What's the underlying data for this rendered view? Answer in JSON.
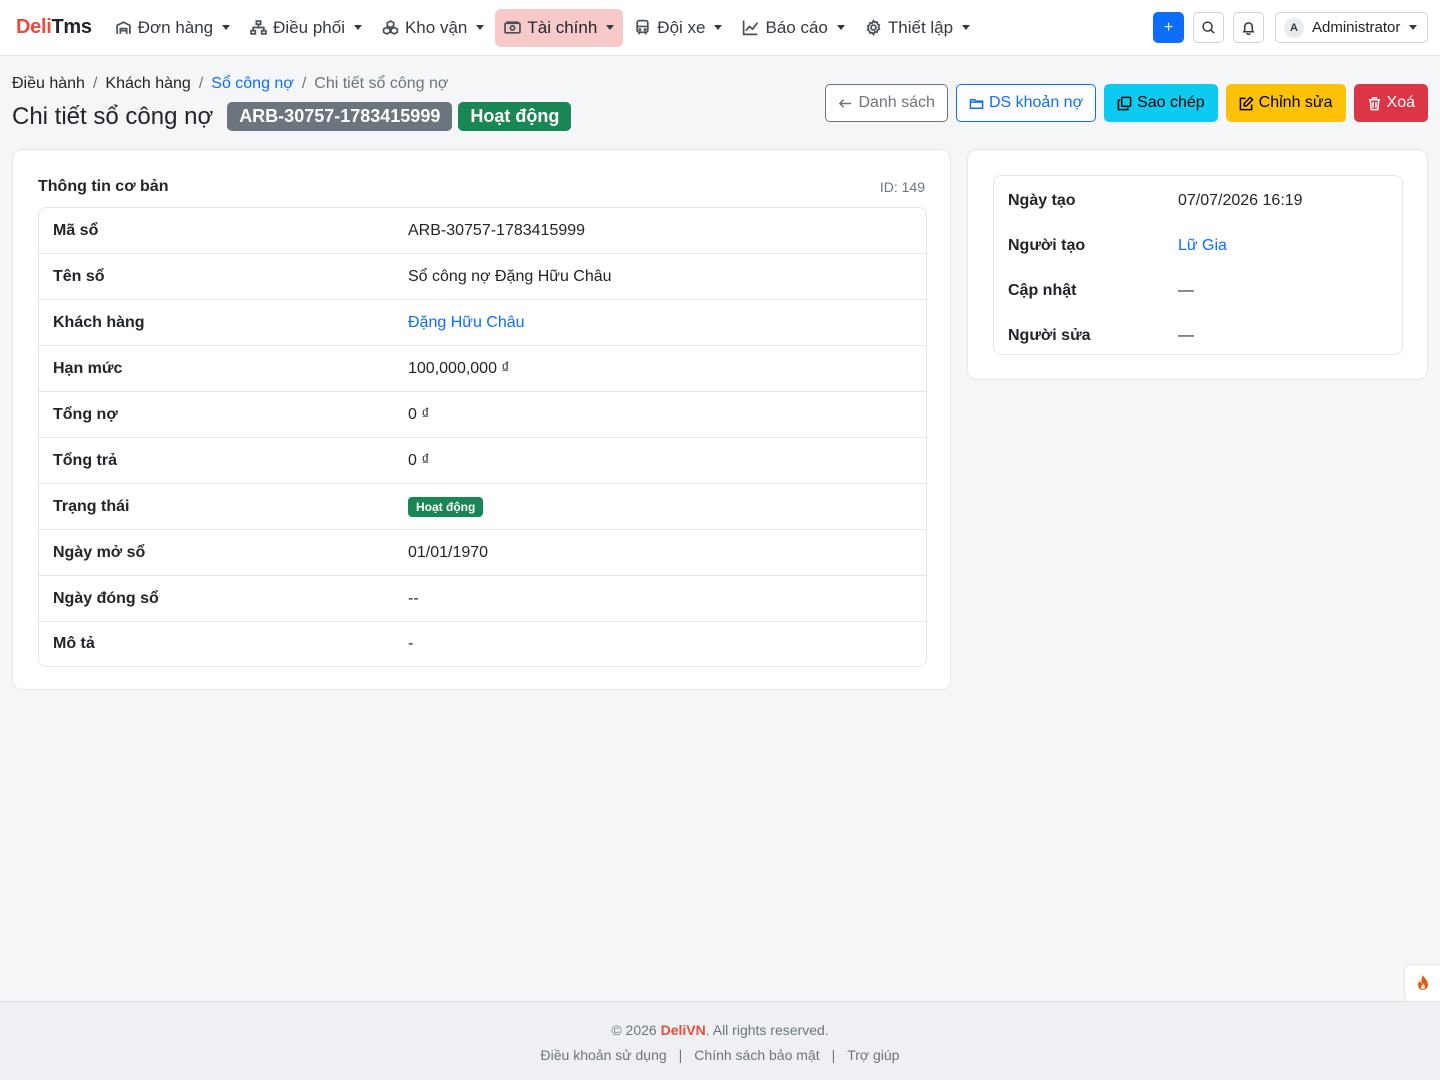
{
  "brand": {
    "part1": "Deli",
    "part2": "Tms"
  },
  "nav": {
    "items": [
      {
        "label": "Đơn hàng",
        "icon": "warehouse-icon"
      },
      {
        "label": "Điều phối",
        "icon": "sitemap-icon"
      },
      {
        "label": "Kho vận",
        "icon": "boxes-icon"
      },
      {
        "label": "Tài chính",
        "icon": "cash-icon",
        "active": true
      },
      {
        "label": "Đội xe",
        "icon": "bus-icon"
      },
      {
        "label": "Báo cáo",
        "icon": "chart-line-icon"
      },
      {
        "label": "Thiết lập",
        "icon": "gear-icon"
      }
    ],
    "add_label": "+",
    "user": {
      "avatar": "A",
      "name": "Administrator"
    }
  },
  "breadcrumb": {
    "items": [
      "Điều hành",
      "Khách hàng",
      "Sổ công nợ",
      "Chi tiết sổ công nợ"
    ],
    "separator": "/"
  },
  "header": {
    "title": "Chi tiết sổ công nợ",
    "code": "ARB-30757-1783415999",
    "status": "Hoạt động"
  },
  "actions": {
    "list": "Danh sách",
    "debts": "DS khoản nợ",
    "copy": "Sao chép",
    "edit": "Chỉnh sửa",
    "delete": "Xoá"
  },
  "basic_info": {
    "title": "Thông tin cơ bản",
    "id_label": "ID: 149",
    "rows": [
      {
        "key": "Mã sổ",
        "value": "ARB-30757-1783415999"
      },
      {
        "key": "Tên sổ",
        "value": "Sổ công nợ Đặng Hữu Châu"
      },
      {
        "key": "Khách hàng",
        "value": "Đặng Hữu Châu"
      },
      {
        "key": "Hạn mức",
        "value": "100,000,000 ₫"
      },
      {
        "key": "Tổng nợ",
        "value": "0 ₫"
      },
      {
        "key": "Tổng trả",
        "value": "0 ₫"
      },
      {
        "key": "Trạng thái",
        "value": "Hoạt động"
      },
      {
        "key": "Ngày mở sổ",
        "value": "01/01/1970"
      },
      {
        "key": "Ngày đóng sổ",
        "value": "--"
      },
      {
        "key": "Mô tả",
        "value": "-"
      }
    ]
  },
  "meta": {
    "rows": [
      {
        "key": "Ngày tạo",
        "value": "07/07/2026 16:19"
      },
      {
        "key": "Người tạo",
        "value": "Lữ Gia"
      },
      {
        "key": "Cập nhật",
        "value": "—"
      },
      {
        "key": "Người sửa",
        "value": "—"
      }
    ]
  },
  "footer": {
    "copyright_prefix": "© 2026 ",
    "brand": "DeliVN",
    "copyright_suffix": ". All rights reserved.",
    "links": [
      "Điều khoản sử dụng",
      "Chính sách bảo mật",
      "Trợ giúp"
    ],
    "separator": "|"
  },
  "colors": {
    "primary": "#0d6efd",
    "success": "#198754",
    "danger": "#dc3545",
    "warning": "#ffc107",
    "info": "#0dcaf0",
    "brand_red": "#e74c3c",
    "active_nav_bg": "#f8c9c9"
  }
}
